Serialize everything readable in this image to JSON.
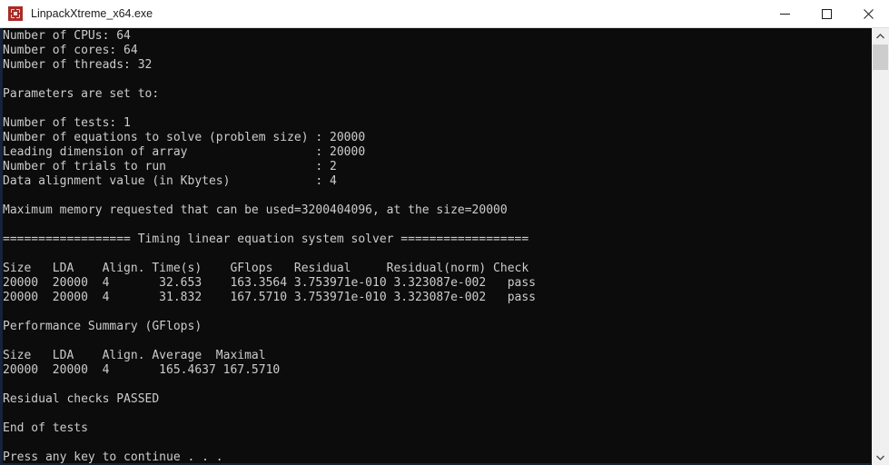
{
  "window": {
    "title": "LinpackXtreme_x64.exe",
    "icon": "linpack-app-icon",
    "controls": {
      "minimize_label": "Minimize",
      "maximize_label": "Maximize",
      "close_label": "Close"
    }
  },
  "console": {
    "foreground_color": "#cccccc",
    "background_color": "#0c0c0c",
    "lines": [
      "Number of CPUs: 64",
      "Number of cores: 64",
      "Number of threads: 32",
      "",
      "Parameters are set to:",
      "",
      "Number of tests: 1",
      "Number of equations to solve (problem size) : 20000",
      "Leading dimension of array                  : 20000",
      "Number of trials to run                     : 2",
      "Data alignment value (in Kbytes)            : 4",
      "",
      "Maximum memory requested that can be used=3200404096, at the size=20000",
      "",
      "================== Timing linear equation system solver ==================",
      "",
      "Size   LDA    Align. Time(s)    GFlops   Residual     Residual(norm) Check",
      "20000  20000  4       32.653    163.3564 3.753971e-010 3.323087e-002   pass",
      "20000  20000  4       31.832    167.5710 3.753971e-010 3.323087e-002   pass",
      "",
      "Performance Summary (GFlops)",
      "",
      "Size   LDA    Align. Average  Maximal",
      "20000  20000  4       165.4637 167.5710",
      "",
      "Residual checks PASSED",
      "",
      "End of tests",
      "",
      "Press any key to continue . . ."
    ],
    "system_info": {
      "cpus": "64",
      "cores": "64",
      "threads": "32"
    },
    "parameters": {
      "number_of_tests": "1",
      "problem_size": "20000",
      "leading_dimension": "20000",
      "trials_to_run": "2",
      "data_alignment_kbytes": "4",
      "max_memory_bytes": "3200404096",
      "max_memory_size": "20000"
    },
    "timing_table": {
      "headers": [
        "Size",
        "LDA",
        "Align.",
        "Time(s)",
        "GFlops",
        "Residual",
        "Residual(norm)",
        "Check"
      ],
      "rows": [
        [
          "20000",
          "20000",
          "4",
          "32.653",
          "163.3564",
          "3.753971e-010",
          "3.323087e-002",
          "pass"
        ],
        [
          "20000",
          "20000",
          "4",
          "31.832",
          "167.5710",
          "3.753971e-010",
          "3.323087e-002",
          "pass"
        ]
      ]
    },
    "summary_table": {
      "title": "Performance Summary (GFlops)",
      "headers": [
        "Size",
        "LDA",
        "Align.",
        "Average",
        "Maximal"
      ],
      "rows": [
        [
          "20000",
          "20000",
          "4",
          "165.4637",
          "167.5710"
        ]
      ]
    },
    "status": {
      "residual_check": "Residual checks PASSED",
      "end_of_tests": "End of tests",
      "prompt": "Press any key to continue . . ."
    }
  },
  "scrollbar": {
    "up_arrow": "scroll-up-arrow",
    "down_arrow": "scroll-down-arrow",
    "thumb": "scroll-thumb"
  }
}
